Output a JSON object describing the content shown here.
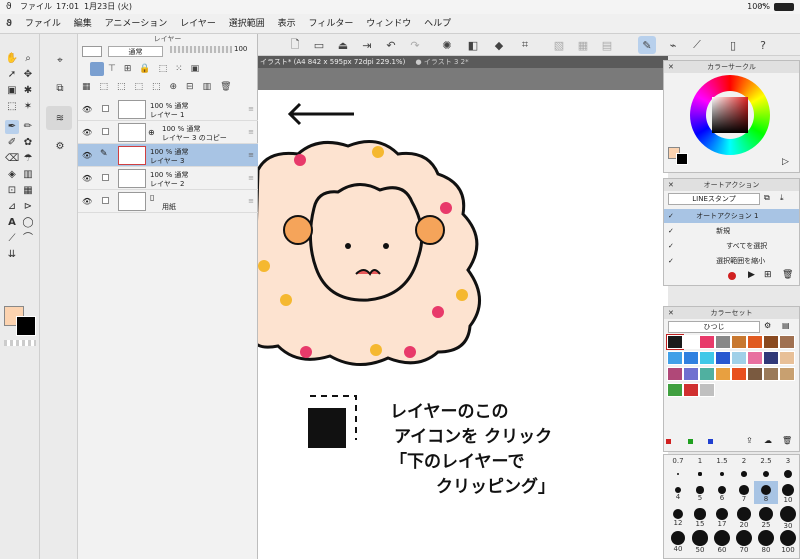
{
  "status": {
    "menu": "ファイル",
    "time": "17:01",
    "date": "1月23日 (火)",
    "battery": "100%"
  },
  "menu": {
    "items": [
      "ファイル",
      "編集",
      "アニメーション",
      "レイヤー",
      "選択範囲",
      "表示",
      "フィルター",
      "ウィンドウ",
      "ヘルプ"
    ]
  },
  "layer_panel": {
    "title": "レイヤー",
    "blend_mode": "通常",
    "opacity": "100",
    "layers": [
      {
        "opacity": "100 % 通常",
        "name": "レイヤー 1"
      },
      {
        "opacity": "100 % 通常",
        "name": "レイヤー 3 のコピー"
      },
      {
        "opacity": "100 % 通常",
        "name": "レイヤー 3"
      },
      {
        "opacity": "100 % 通常",
        "name": "レイヤー 2"
      },
      {
        "opacity": "",
        "name": "用紙"
      }
    ]
  },
  "tabs": {
    "active": "イラスト* (A4 842 x 595px 72dpi 229.1%)",
    "other": "● イラスト 3 2*"
  },
  "canvas": {
    "note_lines": [
      "レイヤーのこの",
      "アイコンを クリック",
      "「下のレイヤーで",
      "クリッピング」"
    ]
  },
  "color_circle": {
    "title": "カラーサークル"
  },
  "auto_action": {
    "title": "オートアクション",
    "set": "LINEスタンプ",
    "items": [
      "オートアクション 1",
      "新規",
      "すべてを選択",
      "選択範囲を縮小"
    ]
  },
  "color_set": {
    "title": "カラーセット",
    "name": "ひつじ",
    "swatches": [
      "#1a1a1a",
      "#ffffff",
      "#e83a6a",
      "#888888",
      "#c87830",
      "#e05a20",
      "#8a4a20",
      "#a07050",
      "#40a0e8",
      "#3080e0",
      "#40c8e8",
      "#2858d0",
      "#a0d0e8",
      "#e870a0",
      "#303878",
      "#e8c098",
      "#b04878",
      "#7070d0",
      "#50b0a0",
      "#e8a040",
      "#e85020",
      "#7a5a40",
      "#9a7a5a",
      "#c8a070",
      "#40a040",
      "#d03030",
      "#c0c0c0"
    ]
  },
  "brush_sizes": {
    "rows": [
      [
        "0.7",
        "1",
        "1.5",
        "2",
        "2.5",
        "3"
      ],
      [
        "4",
        "5",
        "6",
        "7",
        "8",
        "10"
      ],
      [
        "12",
        "15",
        "17",
        "20",
        "25",
        "30"
      ],
      [
        "40",
        "50",
        "60",
        "70",
        "80",
        "100"
      ]
    ]
  }
}
